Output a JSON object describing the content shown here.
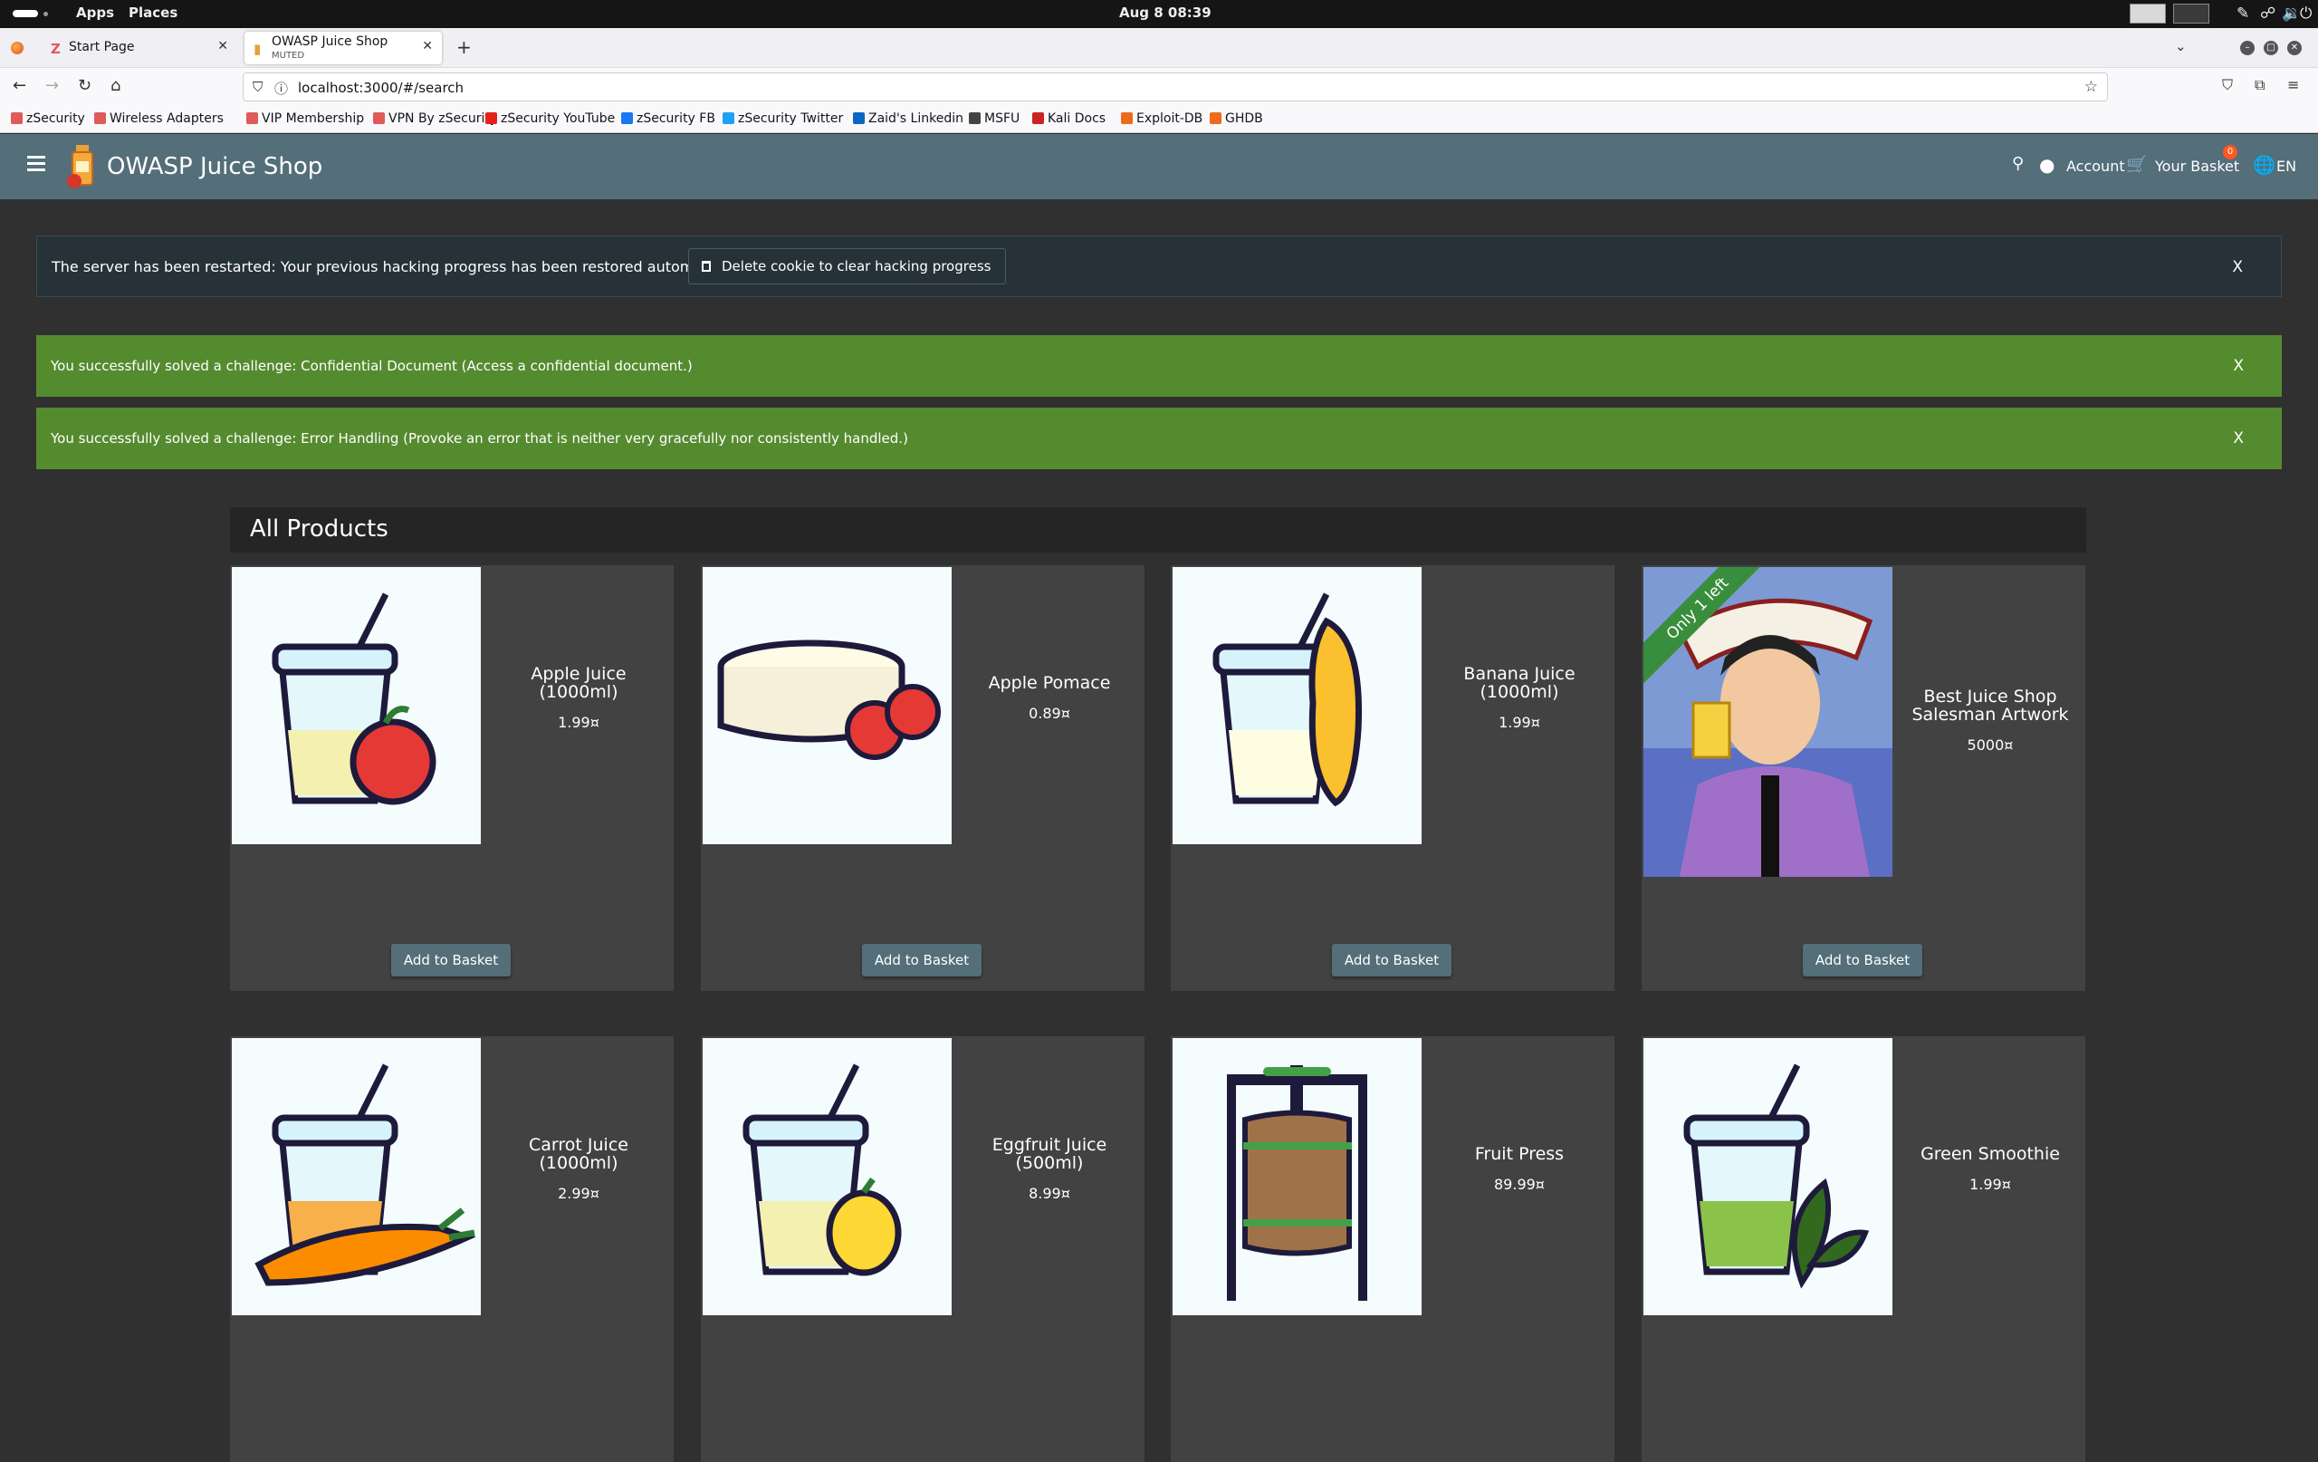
{
  "gnome": {
    "apps": "Apps",
    "places": "Places",
    "clock": "Aug 8  08:39"
  },
  "browser": {
    "tabs": [
      {
        "title": "Start Page",
        "favicon": "zsecurity-icon"
      },
      {
        "title": "OWASP Juice Shop",
        "subtitle": "MUTED",
        "favicon": "juice-shop-icon"
      }
    ],
    "url": "localhost:3000/#/search",
    "bookmarks": [
      {
        "label": "zSecurity",
        "icon": "zsecurity-icon",
        "color": "#e05a5a"
      },
      {
        "label": "Wireless Adapters",
        "icon": "zsecurity-icon",
        "color": "#e05a5a"
      },
      {
        "label": "VIP Membership",
        "icon": "zsecurity-icon",
        "color": "#e05a5a"
      },
      {
        "label": "VPN By zSecurity",
        "icon": "zsecurity-icon",
        "color": "#e05a5a"
      },
      {
        "label": "zSecurity YouTube",
        "icon": "youtube-icon",
        "color": "#e62117"
      },
      {
        "label": "zSecurity FB",
        "icon": "facebook-icon",
        "color": "#1877f2"
      },
      {
        "label": "zSecurity Twitter",
        "icon": "twitter-icon",
        "color": "#1da1f2"
      },
      {
        "label": "Zaid's Linkedin",
        "icon": "linkedin-icon",
        "color": "#0a66c2"
      },
      {
        "label": "MSFU",
        "icon": "globe-icon",
        "color": "#444444"
      },
      {
        "label": "Kali Docs",
        "icon": "kali-icon",
        "color": "#cc2222"
      },
      {
        "label": "Exploit-DB",
        "icon": "exploitdb-icon",
        "color": "#ee6a1c"
      },
      {
        "label": "GHDB",
        "icon": "exploitdb-icon",
        "color": "#ee6a1c"
      }
    ]
  },
  "shop": {
    "title": "OWASP Juice Shop",
    "account": "Account",
    "basket": "Your Basket",
    "basket_count": "0",
    "language": "EN",
    "accent": "#546e7a"
  },
  "notices": {
    "restart_message": "The server has been restarted: Your previous hacking progress has been restored automatically.",
    "delete_cookie": "Delete cookie to clear hacking progress",
    "close": "X",
    "challenges": [
      "You successfully solved a challenge: Confidential Document (Access a confidential document.)",
      "You successfully solved a challenge: Error Handling (Provoke an error that is neither very gracefully nor consistently handled.)"
    ]
  },
  "products": {
    "heading": "All Products",
    "add_label": "Add to Basket",
    "items": [
      {
        "name_lines": [
          "Apple Juice",
          "(1000ml)"
        ],
        "price": "1.99¤"
      },
      {
        "name_lines": [
          "Apple Pomace"
        ],
        "price": "0.89¤"
      },
      {
        "name_lines": [
          "Banana Juice",
          "(1000ml)"
        ],
        "price": "1.99¤"
      },
      {
        "name_lines": [
          "Best Juice Shop",
          "Salesman Artwork"
        ],
        "price": "5000¤",
        "ribbon": "Only 1 left"
      },
      {
        "name_lines": [
          "Carrot Juice",
          "(1000ml)"
        ],
        "price": "2.99¤"
      },
      {
        "name_lines": [
          "Eggfruit Juice",
          "(500ml)"
        ],
        "price": "8.99¤"
      },
      {
        "name_lines": [
          "Fruit Press"
        ],
        "price": "89.99¤"
      },
      {
        "name_lines": [
          "Green Smoothie"
        ],
        "price": "1.99¤"
      }
    ]
  }
}
